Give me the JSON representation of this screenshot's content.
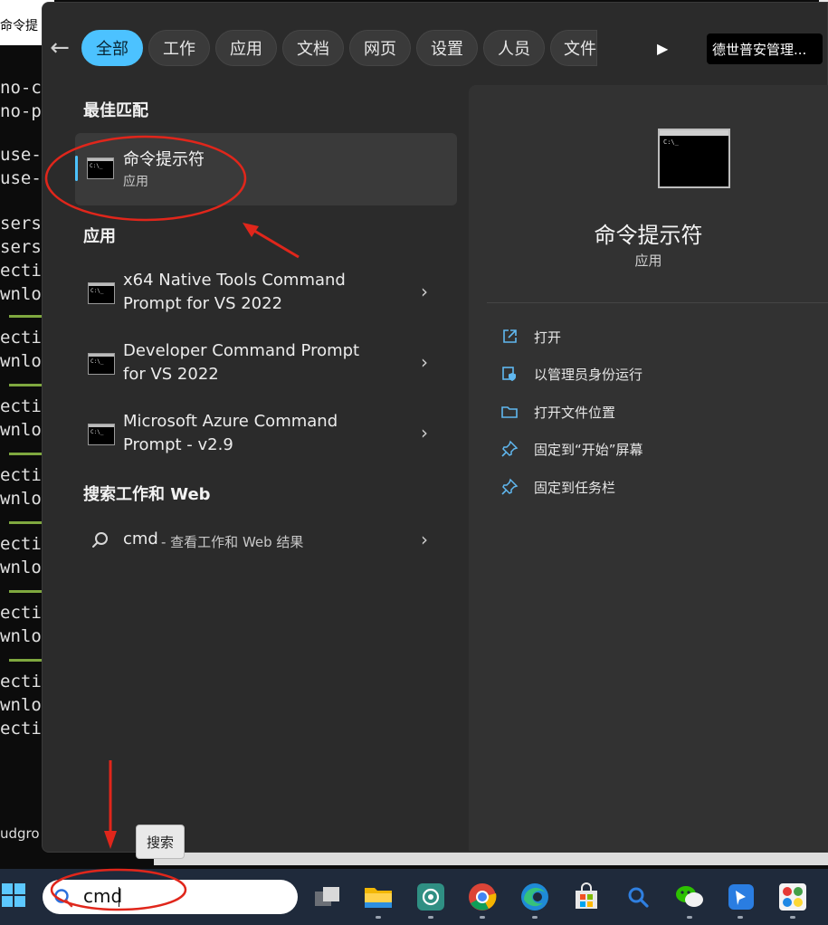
{
  "terminal": {
    "title": "命令提",
    "lines": [
      "no-c",
      "no-p",
      "use-",
      "use-",
      "sers",
      "sers",
      "ecti",
      "wnlo",
      "ecti",
      "wnlo",
      "ecti",
      "wnlo",
      "ecti",
      "wnlo",
      "ecti",
      "wnlo",
      "ecti",
      "wnlo",
      "ecti",
      "wnlo",
      "ecti"
    ],
    "tail": "udgro"
  },
  "tabs": [
    "全部",
    "工作",
    "应用",
    "文档",
    "网页",
    "设置",
    "人员",
    "文件"
  ],
  "account_label": "德世普安管理...",
  "sections": {
    "best_match": "最佳匹配",
    "apps": "应用",
    "web": "搜索工作和 Web"
  },
  "best_match": {
    "name": "命令提示符",
    "type": "应用"
  },
  "apps": [
    {
      "line1": "x64 Native Tools Command",
      "line2": "Prompt for VS 2022"
    },
    {
      "line1": "Developer Command Prompt",
      "line2": "for VS 2022"
    },
    {
      "line1": "Microsoft Azure Command",
      "line2": "Prompt - v2.9"
    }
  ],
  "web_result": {
    "query": "cmd",
    "hint": "- 查看工作和 Web 结果"
  },
  "preview": {
    "name": "命令提示符",
    "type": "应用",
    "actions": [
      "打开",
      "以管理员身份运行",
      "打开文件位置",
      "固定到“开始”屏幕",
      "固定到任务栏"
    ]
  },
  "tooltip": "搜索",
  "taskbar": {
    "search_text": "cmd"
  },
  "colors": {
    "accent": "#4cc2ff",
    "annotation": "#e0261b",
    "menu_bg": "#2b2b2b",
    "taskbar_bg": "#1f2a3b"
  }
}
